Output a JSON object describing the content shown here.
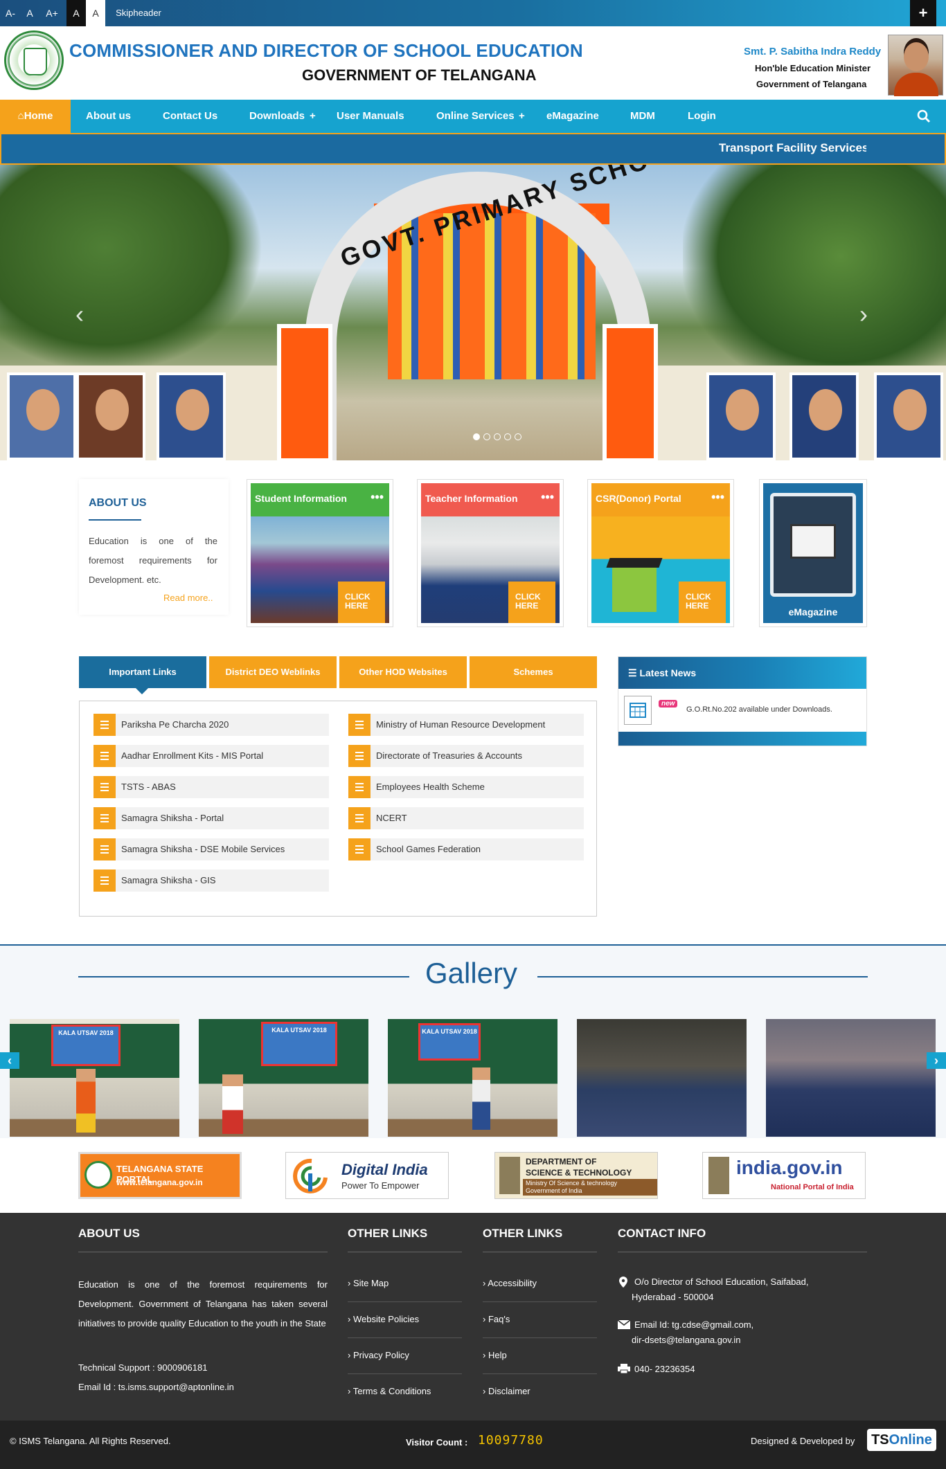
{
  "topbar": {
    "font_decrease": "A-",
    "font_normal": "A",
    "font_increase": "A+",
    "contrast_dark": "A",
    "contrast_light": "A",
    "skip": "Skipheader",
    "plus": "+"
  },
  "header": {
    "title": "COMMISSIONER AND DIRECTOR OF SCHOOL EDUCATION",
    "subtitle": "GOVERNMENT OF TELANGANA",
    "minister_name": "Smt. P. Sabitha Indra Reddy",
    "minister_role": "Hon'ble  Education Minister",
    "minister_state": "Government of Telangana"
  },
  "nav": {
    "home": "Home",
    "items": [
      "About us",
      "Contact Us",
      "Downloads",
      "User Manuals",
      "Online Services",
      "eMagazine",
      "MDM",
      "Login"
    ],
    "dropdown_marker": "+"
  },
  "ticker": {
    "text": "Transport Facility Services"
  },
  "slider": {
    "arch_text": "GOVT. PRIMARY SCHOOL",
    "prev": "‹",
    "next": "›",
    "slide_count": 5,
    "active_slide": 1
  },
  "about": {
    "heading": "ABOUT US",
    "text": "Education is one of the foremost requirements for Development. etc.",
    "read_more": "Read more.."
  },
  "tiles": [
    {
      "title": "Student Information",
      "menu": "•••",
      "cta": "CLICK HERE",
      "color": "#49b243"
    },
    {
      "title": "Teacher Information",
      "menu": "•••",
      "cta": "CLICK HERE",
      "color": "#f05a4f"
    },
    {
      "title": "CSR(Donor) Portal",
      "menu": "•••",
      "cta": "CLICK HERE",
      "color": "#f5a21b"
    },
    {
      "title": "eMagazine",
      "color": "#1d6fa5"
    }
  ],
  "tabs": [
    "Important Links",
    "District DEO Weblinks",
    "Other HOD Websites",
    "Schemes"
  ],
  "links_left": [
    "Pariksha Pe Charcha 2020",
    "Aadhar Enrollment Kits - MIS Portal",
    "TSTS - ABAS",
    "Samagra Shiksha - Portal",
    "Samagra Shiksha - DSE Mobile Services",
    "Samagra Shiksha - GIS"
  ],
  "links_right": [
    "Ministry of Human Resource Development",
    "Directorate of Treasuries & Accounts",
    "Employees Health Scheme",
    "NCERT",
    "School Games Federation"
  ],
  "news": {
    "heading": "Latest News",
    "badge": "new",
    "item": "G.O.Rt.No.202 available under Downloads."
  },
  "gallery": {
    "title": "Gallery",
    "banner_text": "KALA UTSAV 2018",
    "prev": "‹",
    "next": "›"
  },
  "logos": {
    "ts_portal_1": "TELANGANA STATE PORTAL",
    "ts_portal_2": "www.telangana.gov.in",
    "digital_india_1": "Digital India",
    "digital_india_2": "Power To Empower",
    "dst_1": "DEPARTMENT OF",
    "dst_2": "SCIENCE & TECHNOLOGY",
    "dst_3": "Ministry Of Science & technology",
    "dst_4": "Government of India",
    "india_gov_1": "india.gov.in",
    "india_gov_2": "National Portal of India"
  },
  "footer": {
    "about_heading": "ABOUT US",
    "about_text": "Education is one of the foremost requirements for Development. Government of Telangana has taken several initiatives to provide quality Education to the youth in the State",
    "tech_support": "Technical Support : 9000906181",
    "email_support": "Email Id : ts.isms.support@aptonline.in",
    "other_links_heading_1": "OTHER LINKS",
    "other_links_1": [
      "Site Map",
      "Website Policies",
      "Privacy Policy",
      "Terms & Conditions"
    ],
    "other_links_heading_2": "OTHER LINKS",
    "other_links_2": [
      "Accessibility",
      "Faq's",
      "Help",
      "Disclaimer"
    ],
    "contact_heading": "CONTACT INFO",
    "address_1": "O/o Director of School Education, Saifabad,",
    "address_2": "Hyderabad - 500004",
    "email_1": "Email Id: tg.cdse@gmail.com,",
    "email_2": "dir-dsets@telangana.gov.in",
    "phone": "040- 23236354"
  },
  "bottom": {
    "copyright": "© ISMS Telangana. All Rights Reserved.",
    "visitor_label": "Visitor Count :",
    "visitor_count": "10097780",
    "designed_by": "Designed & Developed by",
    "ts_prefix": "TS",
    "ts_suffix": "Online"
  },
  "colors": {
    "primary_blue": "#1d5f96",
    "nav_blue": "#16a3cf",
    "accent_orange": "#f5a21b",
    "footer_dark": "#333333"
  }
}
